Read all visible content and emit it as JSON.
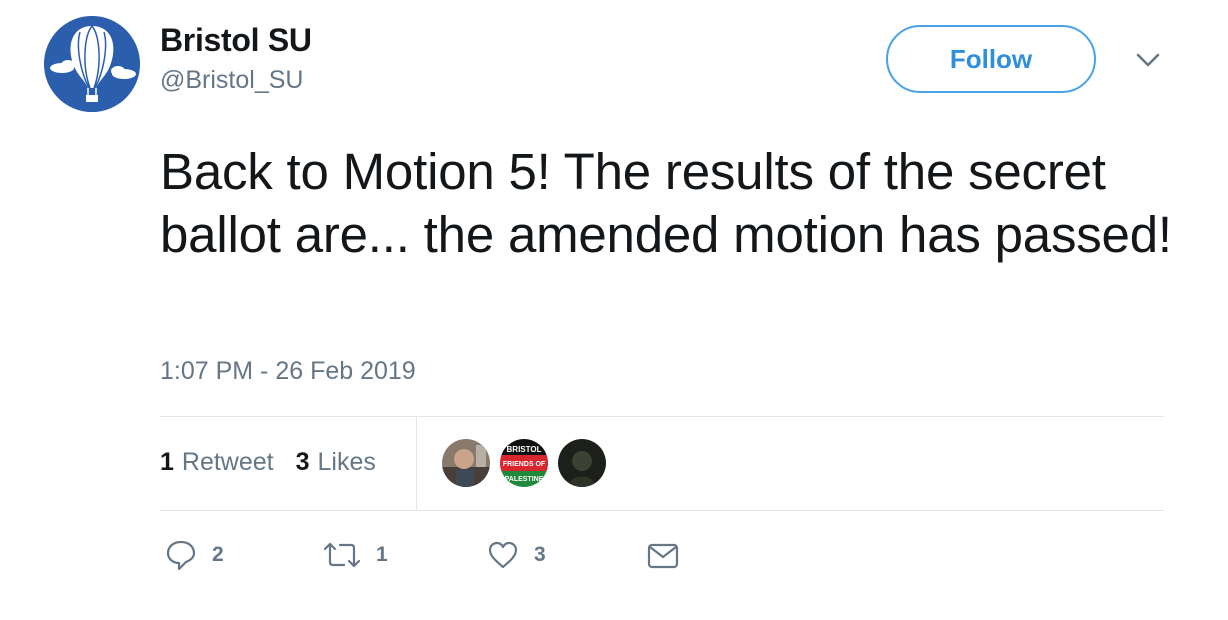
{
  "user": {
    "name": "Bristol SU",
    "handle": "@Bristol_SU"
  },
  "follow_label": "Follow",
  "tweet": {
    "text": "Back to Motion 5! The results of the secret ballot are... the amended motion has passed!",
    "timestamp": "1:07 PM - 26 Feb 2019"
  },
  "stats": {
    "retweets_count": "1",
    "retweets_label": "Retweet",
    "likes_count": "3",
    "likes_label": "Likes"
  },
  "liker_badge": {
    "line1": "BRISTOL",
    "line2": "FRIENDS OF",
    "line3": "PALESTINE"
  },
  "actions": {
    "reply_count": "2",
    "retweet_count": "1",
    "like_count": "3"
  },
  "colors": {
    "accent": "#1da1f2",
    "avatar_bg": "#2b5fae",
    "muted_text": "#657786"
  },
  "icons": [
    "balloon-logo-icon",
    "chevron-down-icon",
    "reply-icon",
    "retweet-icon",
    "heart-icon",
    "mail-icon"
  ]
}
